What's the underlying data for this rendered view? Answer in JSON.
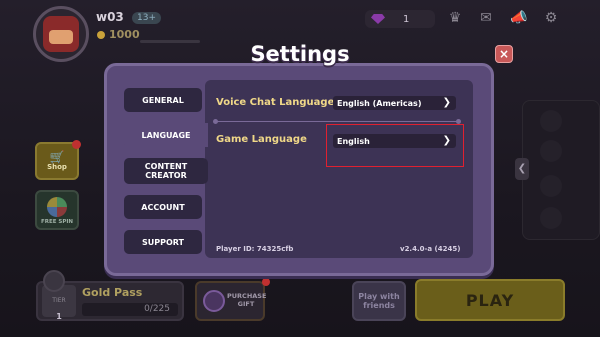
{
  "player": {
    "username": "w03",
    "level": "13+",
    "coins": "1000"
  },
  "currency": {
    "gems": "1"
  },
  "top_icons": [
    "ranking-icon",
    "mail-icon",
    "announcement-icon",
    "gear-icon"
  ],
  "side": {
    "shop_label": "Shop",
    "freespin_label": "FREE SPIN"
  },
  "bottom": {
    "gold_pass_title": "Gold Pass",
    "tier_label": "TIER",
    "tier_value": "1",
    "gold_pass_progress": "0/225",
    "purchase_gift_label": "PURCHASE GIFT",
    "play_with_friends_label": "Play with friends",
    "play_label": "PLAY"
  },
  "modal": {
    "title": "Settings",
    "close_label": "×",
    "tabs": [
      {
        "label": "GENERAL"
      },
      {
        "label": "LANGUAGE",
        "active": true
      },
      {
        "label": "CONTENT CREATOR"
      },
      {
        "label": "ACCOUNT"
      },
      {
        "label": "SUPPORT"
      }
    ],
    "settings": [
      {
        "label": "Voice Chat Language",
        "value": "English (Americas)"
      },
      {
        "label": "Game Language",
        "value": "English"
      }
    ],
    "player_id": "Player ID: 74325cfb",
    "version": "v2.4.0-a (4245)"
  },
  "colors": {
    "modal_bg": "#5a4a78",
    "tab_bg": "#2e2740",
    "label_gold": "#f0d888",
    "highlight_red": "#e02030",
    "close_red": "#c85858"
  }
}
